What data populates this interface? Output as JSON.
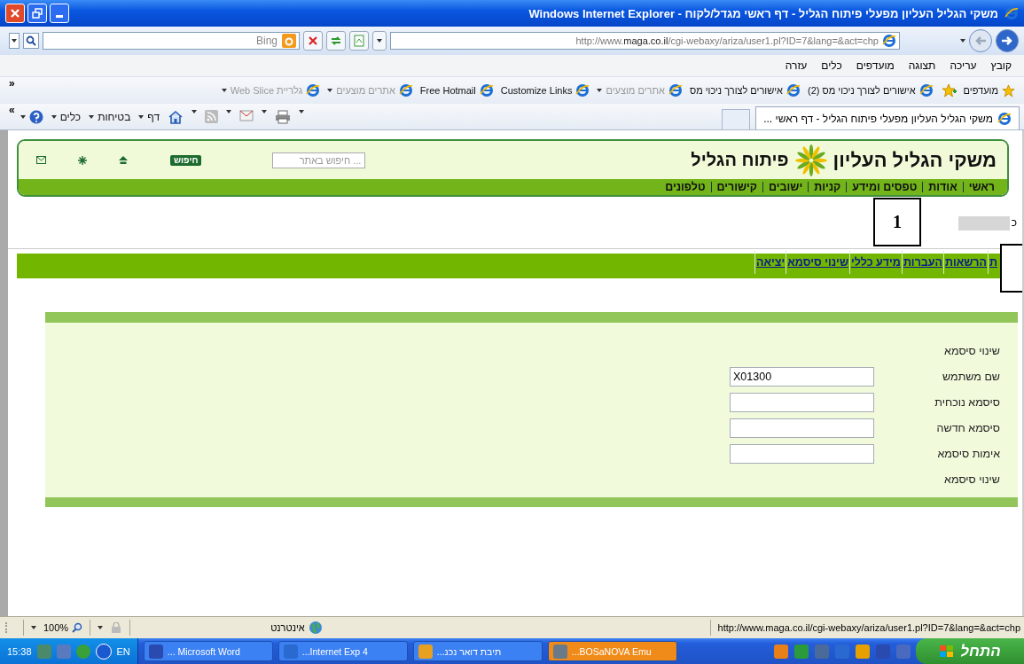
{
  "window": {
    "title": "משקי הגליל העליון מפעלי פיתוח הגליל - דף ראשי מגדל/לקוח - Windows Internet Explorer"
  },
  "address_bar": {
    "url": "http://www.**maga.co.il**/cgi-webaxy/ariza/user1.pl?ID=7&lang=&act=chp"
  },
  "search": {
    "placeholder": "Bing"
  },
  "menu": [
    "קובץ",
    "עריכה",
    "תצוגה",
    "מועדפים",
    "כלים",
    "עזרה"
  ],
  "favorites_bar": {
    "chevron": "«",
    "label": "מועדפים",
    "items": [
      {
        "label": "אישורים לצורך ניכוי מס (2)",
        "kind": "link",
        "disabled": false
      },
      {
        "label": "אישורים לצורך ניכוי מס",
        "kind": "link",
        "disabled": false
      },
      {
        "label": "אתרים מוצעים",
        "kind": "dropdown",
        "disabled": true
      },
      {
        "label": "Customize Links",
        "kind": "link",
        "disabled": false
      },
      {
        "label": "Free Hotmail",
        "kind": "link",
        "disabled": false
      },
      {
        "label": "אתרים מוצעים",
        "kind": "dropdown",
        "disabled": true
      },
      {
        "label": "גלריית Web Slice",
        "kind": "dropdown",
        "disabled": true
      }
    ]
  },
  "tabs": [
    {
      "label": "משקי הגליל העליון מפעלי פיתוח הגליל - דף ראשי ...",
      "selected": true
    }
  ],
  "command_bar": {
    "chevron": "«",
    "items": [
      "דף",
      "בטיחות",
      "כלים"
    ]
  },
  "site": {
    "title": "משקי הגליל העליון",
    "subtitle": "פיתוח הגליל",
    "search": {
      "placeholder": "חיפוש באתר ...",
      "button": "חיפוש"
    },
    "nav": [
      "ראשי",
      "אודות",
      "טפסים ומידע",
      "קניות",
      "ישובים",
      "קישורים",
      "טלפונים"
    ]
  },
  "greeting": "כ",
  "annotations": [
    "1"
  ],
  "account_menu": [
    "ת",
    "הרשאות",
    "העברות",
    "מידע כללי",
    "שינוי סיסמא",
    "יציאה"
  ],
  "form": {
    "title": "שינוי סיסמא",
    "fields": [
      {
        "label": "שם משתמש",
        "value": "X01300"
      },
      {
        "label": "סיסמא נוכחית"
      },
      {
        "label": "סיסמא חדשה"
      },
      {
        "label": "אימות סיסמא"
      }
    ],
    "submit": "שינוי סיסמא"
  },
  "status_bar": {
    "url": "http://www.maga.co.il/cgi-webaxy/ariza/user1.pl?ID=7&lang=&act=chp",
    "zone": "אינטרנט",
    "zoom": "100%"
  },
  "taskbar": {
    "start": "התחל",
    "windows": [
      {
        "label": "...BOSaNOVA Emu",
        "flashing": true
      },
      {
        "label": "תיבת דואר נכנ...",
        "flashing": false
      },
      {
        "label": "...Internet Exp 4",
        "flashing": false
      },
      {
        "label": "... Microsoft Word",
        "flashing": false
      }
    ],
    "language": "EN",
    "clock": "15:38"
  }
}
